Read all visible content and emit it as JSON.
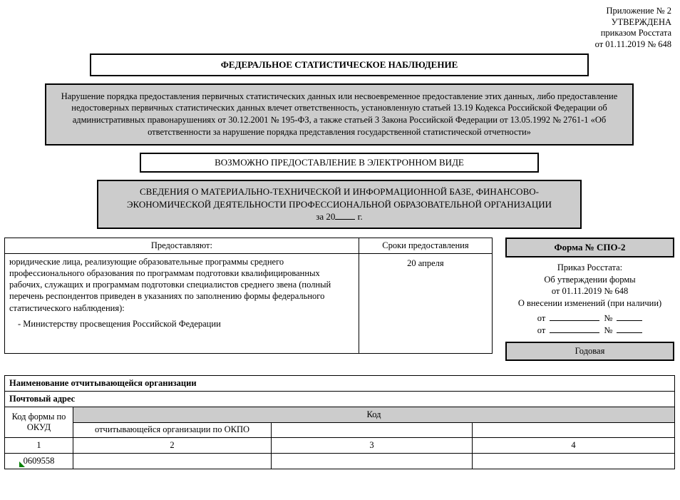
{
  "header": {
    "appendix": "Приложение № 2",
    "approved": "УТВЕРЖДЕНА",
    "order": "приказом Росстата",
    "order_date": "от 01.11.2019 № 648"
  },
  "title_box": "ФЕДЕРАЛЬНОЕ СТАТИСТИЧЕСКОЕ НАБЛЮДЕНИЕ",
  "warning": "Нарушение порядка предоставления первичных статистических данных или несвоевременное предоставление этих данных, либо предоставление недостоверных первичных статистических данных влечет ответственность, установленную статьей 13.19 Кодекса Российской Федерации об административных правонарушениях от 30.12.2001 № 195-ФЗ, а также статьей 3 Закона Российской Федерации от 13.05.1992 № 2761-1 «Об ответственности за нарушение порядка представления государственной статистической отчетности»",
  "electronic": "ВОЗМОЖНО ПРЕДОСТАВЛЕНИЕ В ЭЛЕКТРОННОМ ВИДЕ",
  "info": {
    "line1": "СВЕДЕНИЯ О МАТЕРИАЛЬНО-ТЕХНИЧЕСКОЙ И ИНФОРМАЦИОННОЙ БАЗЕ, ФИНАНСОВО-ЭКОНОМИЧЕСКОЙ ДЕЯТЕЛЬНОСТИ ПРОФЕССИОНАЛЬНОЙ ОБРАЗОВАТЕЛЬНОЙ ОРГАНИЗАЦИИ",
    "year_prefix": "за 20",
    "year_suffix": "г."
  },
  "prov_table": {
    "col1_header": "Предоставляют:",
    "col2_header": "Сроки предоставления",
    "body_main": "юридические лица, реализующие образовательные программы среднего профессионального образования по программам подготовки квалифицированных рабочих, служащих и программам подготовки специалистов среднего звена (полный перечень респондентов приведен в указаниях по заполнению формы федерального статистического наблюдения):",
    "body_indent": "-  Министерству просвещения Российской Федерации",
    "deadline": "20 апреля"
  },
  "right": {
    "form_number": "Форма № СПО-2",
    "meta1": "Приказ Росстата:",
    "meta2": "Об утверждении формы",
    "meta3": "от 01.11.2019 № 648",
    "meta4": "О внесении изменений (при наличии)",
    "ot_label": "от",
    "num_label": "№",
    "period": "Годовая"
  },
  "org": {
    "org_name_label": "Наименование отчитывающейся организации",
    "post_addr_label": "Почтовый адрес",
    "code_form_okud_label": "Код формы по ОКУД",
    "code_header": "Код",
    "sub2": "отчитывающейся организации по ОКПО",
    "num1": "1",
    "num2": "2",
    "num3": "3",
    "num4": "4",
    "okud_value": "0609558"
  }
}
